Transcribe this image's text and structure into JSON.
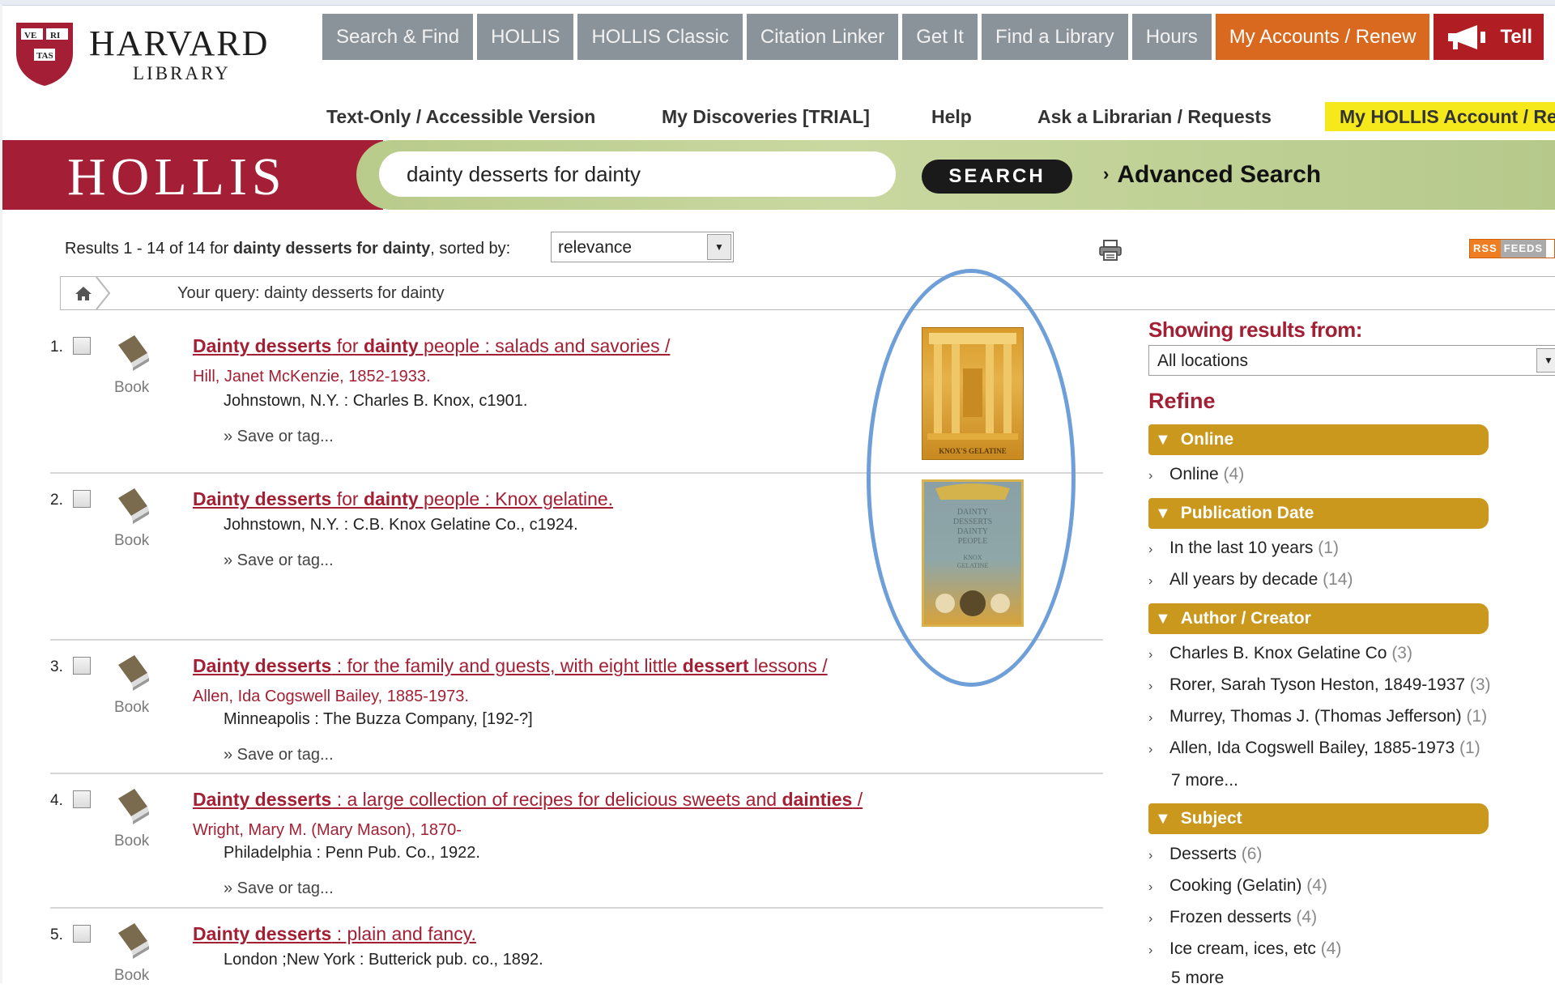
{
  "logo": {
    "title": "HARVARD",
    "subtitle": "LIBRARY",
    "shield_text": [
      "VE",
      "RI",
      "TAS"
    ]
  },
  "topnav": [
    {
      "label": "Search & Find"
    },
    {
      "label": "HOLLIS"
    },
    {
      "label": "HOLLIS Classic"
    },
    {
      "label": "Citation Linker"
    },
    {
      "label": "Get It"
    },
    {
      "label": "Find a Library"
    },
    {
      "label": "Hours"
    },
    {
      "label": "My Accounts / Renew"
    },
    {
      "label": "Tell"
    }
  ],
  "subnav": [
    {
      "label": "Text-Only / Accessible Version"
    },
    {
      "label": "My Discoveries [TRIAL]"
    },
    {
      "label": "Help"
    },
    {
      "label": "Ask a Librarian / Requests"
    }
  ],
  "my_account_label": "My HOLLIS Account / Re",
  "hollis": {
    "logo": "HOLLIS",
    "query": "dainty desserts for dainty",
    "search_label": "SEARCH",
    "advanced_label": "Advanced Search"
  },
  "results_header": {
    "prefix": "Results 1 - 14 of 14 for ",
    "query_bold": "dainty desserts for dainty",
    "suffix": ", sorted by:",
    "sort_value": "relevance",
    "rss_a": "RSS",
    "rss_b": "FEEDS",
    "query_line": "Your query: dainty desserts for dainty"
  },
  "results": [
    {
      "num": "1.",
      "type": "Book",
      "title_parts": [
        [
          "b",
          "Dainty desserts"
        ],
        [
          "t",
          " for "
        ],
        [
          "b",
          "dainty"
        ],
        [
          "t",
          " people : salads and savories /"
        ]
      ],
      "author": "Hill, Janet McKenzie, 1852-1933.",
      "pub": "Johnstown, N.Y. : Charles B. Knox, c1901.",
      "save": "» Save or tag..."
    },
    {
      "num": "2.",
      "type": "Book",
      "title_parts": [
        [
          "b",
          "Dainty desserts"
        ],
        [
          "t",
          " for "
        ],
        [
          "b",
          "dainty"
        ],
        [
          "t",
          " people : Knox gelatine."
        ]
      ],
      "author": "",
      "pub": "Johnstown, N.Y. : C.B. Knox Gelatine Co., c1924.",
      "save": "» Save or tag..."
    },
    {
      "num": "3.",
      "type": "Book",
      "title_parts": [
        [
          "b",
          "Dainty desserts"
        ],
        [
          "t",
          " : for the family and guests, with eight little "
        ],
        [
          "b",
          "dessert"
        ],
        [
          "t",
          " lessons /"
        ]
      ],
      "author": "Allen, Ida Cogswell Bailey, 1885-1973.",
      "pub": "Minneapolis : The Buzza Company, [192-?]",
      "save": "» Save or tag..."
    },
    {
      "num": "4.",
      "type": "Book",
      "title_parts": [
        [
          "b",
          "Dainty desserts"
        ],
        [
          "t",
          " : a large collection of recipes for delicious sweets and "
        ],
        [
          "b",
          "dainties"
        ],
        [
          "t",
          " /"
        ]
      ],
      "author": "Wright, Mary M. (Mary Mason), 1870-",
      "pub": "Philadelphia : Penn Pub. Co., 1922.",
      "save": "» Save or tag..."
    },
    {
      "num": "5.",
      "type": "Book",
      "title_parts": [
        [
          "b",
          "Dainty desserts"
        ],
        [
          "t",
          " : plain and fancy."
        ]
      ],
      "author": "",
      "pub": "London ;New York : Butterick pub. co., 1892.",
      "save": ""
    }
  ],
  "covers": [
    {
      "caption": "KNOX'S GELATINE"
    },
    {
      "text_lines": [
        "DAINTY",
        "DESSERTS",
        "DAINTY",
        "PEOPLE",
        "KNOX",
        "GELATINE"
      ]
    }
  ],
  "sidebar": {
    "showing_title": "Showing results from:",
    "location_value": "All locations",
    "refine_title": "Refine",
    "facets": [
      {
        "title": "Online",
        "items": [
          {
            "label": "Online",
            "count": "(4)"
          }
        ],
        "more": ""
      },
      {
        "title": "Publication Date",
        "items": [
          {
            "label": "In the last 10 years",
            "count": "(1)"
          },
          {
            "label": "All years by decade",
            "count": "(14)"
          }
        ],
        "more": ""
      },
      {
        "title": "Author / Creator",
        "items": [
          {
            "label": "Charles B. Knox Gelatine Co",
            "count": "(3)"
          },
          {
            "label": "Rorer, Sarah Tyson Heston, 1849-1937",
            "count": "(3)"
          },
          {
            "label": "Murrey, Thomas J. (Thomas Jefferson)",
            "count": "(1)"
          },
          {
            "label": "Allen, Ida Cogswell Bailey, 1885-1973",
            "count": "(1)"
          }
        ],
        "more": "7 more..."
      },
      {
        "title": "Subject",
        "items": [
          {
            "label": "Desserts",
            "count": "(6)"
          },
          {
            "label": "Cooking (Gelatin)",
            "count": "(4)"
          },
          {
            "label": "Frozen desserts",
            "count": "(4)"
          },
          {
            "label": "Ice cream, ices, etc",
            "count": "(4)"
          }
        ],
        "more": "5 more"
      }
    ]
  },
  "colors": {
    "crimson": "#a31f34",
    "accent_orange": "#d8691f",
    "facet_gold": "#c9981c",
    "annotation_blue": "#6e9fd8",
    "highlight_yellow": "#f5e91b"
  }
}
